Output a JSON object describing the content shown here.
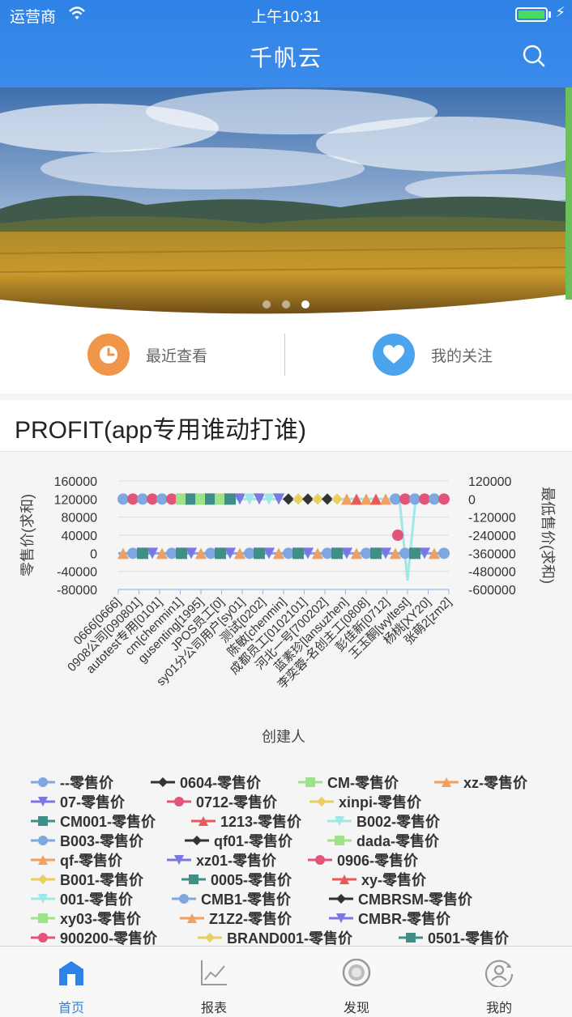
{
  "status": {
    "carrier": "运营商",
    "time": "上午10:31"
  },
  "nav": {
    "title": "千帆云"
  },
  "banner": {
    "slides": 3,
    "active_slide": 3
  },
  "quick_links": [
    {
      "label": "最近查看",
      "icon": "clock-icon",
      "color": "#f0964a"
    },
    {
      "label": "我的关注",
      "icon": "heart-icon",
      "color": "#4aa5ee"
    }
  ],
  "report": {
    "title": "PROFIT(app专用谁动打谁)"
  },
  "chart_data": {
    "type": "line",
    "xlabel": "创建人",
    "ylabel_left": "零售价(求和)",
    "ylabel_right": "最低售价(求和)",
    "yticks_left": [
      "160000",
      "120000",
      "80000",
      "40000",
      "0",
      "-40000",
      "-80000"
    ],
    "yticks_right": [
      "120000",
      "0",
      "-120000",
      "-240000",
      "-360000",
      "-480000",
      "-600000"
    ],
    "ylim_left": [
      -80000,
      160000
    ],
    "ylim_right": [
      -600000,
      120000
    ],
    "categories": [
      "0666[0666]",
      "0908公司[090801]",
      "autotest专用[0101]",
      "cm[chenmin1]",
      "gusenting[1995]",
      "JPOS员工[0]",
      "sy01分公司用户[sy01]",
      "测试[0202]",
      "陈敏[chenmin]",
      "成都员工[0102101]",
      "河北一号[700202]",
      "蓝素珍[lansuzhen]",
      "李奕蓉-名创主工[0808]",
      "彭佳新[0712]",
      "王玉酮[wyltest]",
      "杨桃[XY20]",
      "张萌2[zm2]"
    ],
    "upper_band_value": 120000,
    "lower_band_value": 0,
    "notable_points": [
      {
        "series": "0712-零售价",
        "category": "王玉酮[wyltest]",
        "value": 40000
      },
      {
        "series": "001-零售价",
        "category": "王玉酮[wyltest]",
        "value": -60000
      }
    ],
    "grid": true,
    "legend_position": "bottom",
    "series": [
      {
        "name": "--零售价",
        "marker": "circle",
        "color": "#7fa8e0"
      },
      {
        "name": "0604-零售价",
        "marker": "diamond",
        "color": "#333333"
      },
      {
        "name": "CM-零售价",
        "marker": "square",
        "color": "#9ee28a"
      },
      {
        "name": "xz-零售价",
        "marker": "triangle",
        "color": "#f0a060"
      },
      {
        "name": "07-零售价",
        "marker": "triangle-down",
        "color": "#7b78e0"
      },
      {
        "name": "0712-零售价",
        "marker": "circle",
        "color": "#e25578"
      },
      {
        "name": "xinpi-零售价",
        "marker": "diamond",
        "color": "#e8d060"
      },
      {
        "name": "CM001-零售价",
        "marker": "square",
        "color": "#3f8f88"
      },
      {
        "name": "1213-零售价",
        "marker": "triangle",
        "color": "#e85a5a"
      },
      {
        "name": "B002-零售价",
        "marker": "triangle-down",
        "color": "#9fe8e8"
      },
      {
        "name": "B003-零售价",
        "marker": "circle",
        "color": "#7fa8e0"
      },
      {
        "name": "qf01-零售价",
        "marker": "diamond",
        "color": "#333333"
      },
      {
        "name": "dada-零售价",
        "marker": "square",
        "color": "#9ee28a"
      },
      {
        "name": "qf-零售价",
        "marker": "triangle",
        "color": "#f0a060"
      },
      {
        "name": "xz01-零售价",
        "marker": "triangle-down",
        "color": "#7b78e0"
      },
      {
        "name": "0906-零售价",
        "marker": "circle",
        "color": "#e25578"
      },
      {
        "name": "B001-零售价",
        "marker": "diamond",
        "color": "#e8d060"
      },
      {
        "name": "0005-零售价",
        "marker": "square",
        "color": "#3f8f88"
      },
      {
        "name": "xy-零售价",
        "marker": "triangle",
        "color": "#e85a5a"
      },
      {
        "name": "001-零售价",
        "marker": "triangle-down",
        "color": "#9fe8e8"
      },
      {
        "name": "CMB1-零售价",
        "marker": "circle",
        "color": "#7fa8e0"
      },
      {
        "name": "CMBRSM-零售价",
        "marker": "diamond",
        "color": "#333333"
      },
      {
        "name": "xy03-零售价",
        "marker": "square",
        "color": "#9ee28a"
      },
      {
        "name": "Z1Z2-零售价",
        "marker": "triangle",
        "color": "#f0a060"
      },
      {
        "name": "CMBR-零售价",
        "marker": "triangle-down",
        "color": "#7b78e0"
      },
      {
        "name": "900200-零售价",
        "marker": "circle",
        "color": "#e25578"
      },
      {
        "name": "BRAND001-零售价",
        "marker": "diamond",
        "color": "#e8d060"
      },
      {
        "name": "0501-零售价",
        "marker": "square",
        "color": "#3f8f88"
      }
    ]
  },
  "tabs": [
    {
      "label": "首页",
      "icon": "home-icon",
      "active": true
    },
    {
      "label": "报表",
      "icon": "chart-icon",
      "active": false
    },
    {
      "label": "发现",
      "icon": "discover-icon",
      "active": false
    },
    {
      "label": "我的",
      "icon": "profile-icon",
      "active": false
    }
  ],
  "colors": {
    "primary": "#2f82e6",
    "tab_inactive": "#9a9a9a"
  }
}
